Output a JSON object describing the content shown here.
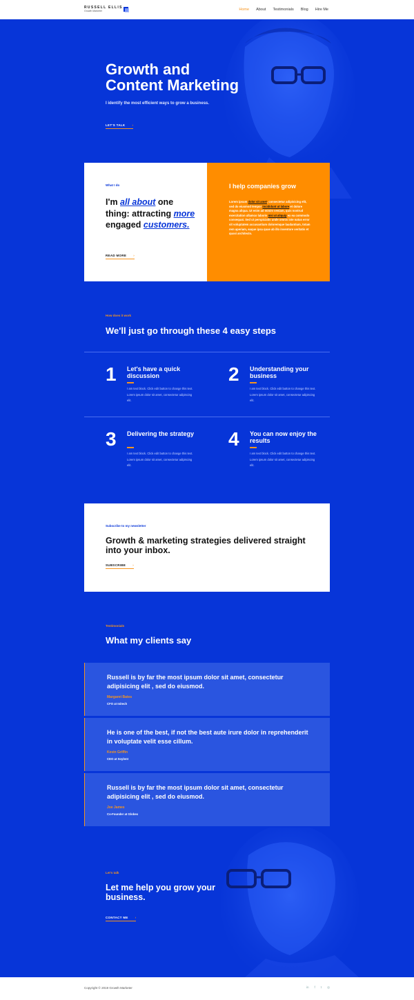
{
  "brand": {
    "name": "RUSSELL ELLIS",
    "tagline": "Growth Marketer"
  },
  "nav": [
    {
      "label": "Home",
      "active": true
    },
    {
      "label": "About"
    },
    {
      "label": "Testimonials"
    },
    {
      "label": "Blog"
    },
    {
      "label": "Hire Me"
    }
  ],
  "hero": {
    "title_line1": "Growth and",
    "title_line2": "Content Marketing",
    "subtitle": "I identify the most efficient ways to grow a business.",
    "cta": "LET'S TALK"
  },
  "what_i_do": {
    "eyebrow": "What I do",
    "title_a": "I'm ",
    "title_em1": "all about",
    "title_b": " one thing: attracting ",
    "title_em2": "more",
    "title_c": " engaged ",
    "title_em3": "customers.",
    "cta": "READ MORE"
  },
  "help": {
    "title": "I help companies grow",
    "text_1": "Lorem ipsum ",
    "text_hl1": "dolor sit amet",
    "text_2": ", consectetur adipisicing elit, sed do eiusmod tempor ",
    "text_hl2": "incididunt ut labore",
    "text_3": " et dolore magna aliqua. Ut enim ad minim veniam, quis nostrud exercitation ullamco laboris ",
    "text_hl3": "nisi ut aliquip",
    "text_4": " ex ea commodo consequat. Sed ut perspiciatis unde omnis iste natus error sit voluptatem accusantium doloremque laudantium, totam rem aperiam, eaque ipsa quae ab illo inventore veritatis et quasi architecto."
  },
  "how": {
    "eyebrow": "How does it work",
    "title": "We'll just go through these 4 easy steps",
    "steps": [
      {
        "num": "1",
        "title": "Let's have a quick discussion",
        "text": "I am text block. Click edit button to change this text. Lorem ipsum dolor sit amet, consectetur adipiscing elit."
      },
      {
        "num": "2",
        "title": "Understanding your business",
        "text": "I am text block. Click edit button to change this text. Lorem ipsum dolor sit amet, consectetur adipiscing elit."
      },
      {
        "num": "3",
        "title": "Delivering the strategy",
        "text": "I am text block. Click edit button to change this text. Lorem ipsum dolor sit amet, consectetur adipiscing elit."
      },
      {
        "num": "4",
        "title": "You can now enjoy the results",
        "text": "I am text block. Click edit button to change this text. Lorem ipsum dolor sit amet, consectetur adipiscing elit."
      }
    ]
  },
  "newsletter": {
    "eyebrow": "Subscribe to my newsletter",
    "title": "Growth & marketing strategies delivered straight into your inbox.",
    "cta": "SUBSCRIBE"
  },
  "testimonials": {
    "eyebrow": "Testimonials",
    "title": "What my clients say",
    "items": [
      {
        "quote": "Russell is by far the most ipsum dolor sit amet, consectetur adipisicing elit , sed do eiusmod.",
        "name": "Margaret Bates",
        "role": "CFO at Initech"
      },
      {
        "quote": "He is one of the best, if not the best aute irure dolor in reprehenderit in voluptate velit esse cillum.",
        "name": "Kevin Griffin",
        "role": "CEO at Soylent"
      },
      {
        "quote": "Russell is by far the most ipsum dolor sit amet, consectetur adipisicing elit , sed do eiusmod.",
        "name": "Joe James",
        "role": "Co-Founder at Globex"
      }
    ]
  },
  "lets_talk": {
    "eyebrow": "Let's talk",
    "title": "Let me help you grow your business.",
    "cta": "CONTACT ME"
  },
  "footer": {
    "copyright": "Copyright © 2019 Growth Marketer",
    "social": [
      {
        "icon": "linkedin-icon",
        "glyph": "in"
      },
      {
        "icon": "facebook-icon",
        "glyph": "f"
      },
      {
        "icon": "twitter-icon",
        "glyph": "t"
      },
      {
        "icon": "instagram-icon",
        "glyph": "◎"
      }
    ]
  },
  "colors": {
    "primary": "#0735d8",
    "accent": "#f7941d",
    "orange_card": "#ff8d00",
    "white": "#ffffff"
  }
}
